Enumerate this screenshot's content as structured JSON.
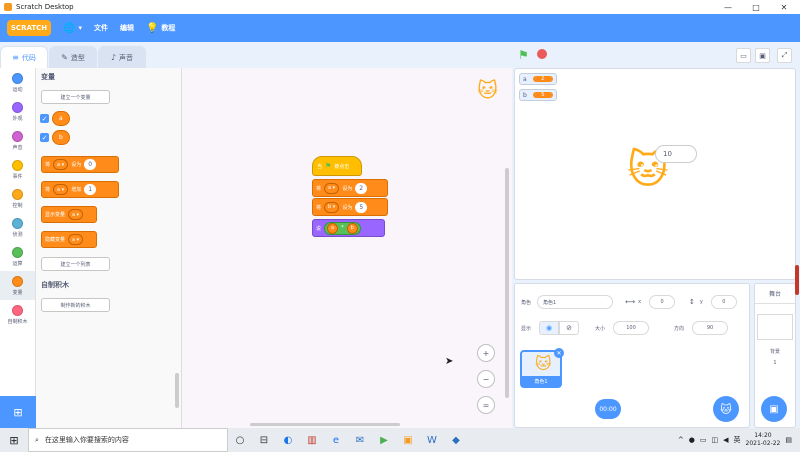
{
  "window": {
    "title": "Scratch Desktop",
    "controls": [
      "—",
      "□",
      "✕"
    ]
  },
  "menubar": {
    "logo_text": "SCRATCH",
    "items": [
      {
        "icon": "globe-icon",
        "label": ""
      },
      {
        "icon": "",
        "label": "文件"
      },
      {
        "icon": "",
        "label": "编辑"
      },
      {
        "icon": "lightbulb-icon",
        "label": "教程"
      }
    ]
  },
  "tabs": [
    {
      "label": "代码",
      "icon": "code-icon",
      "active": true
    },
    {
      "label": "造型",
      "icon": "brush-icon",
      "active": false
    },
    {
      "label": "声音",
      "icon": "speaker-icon",
      "active": false
    }
  ],
  "categories": [
    {
      "label": "运动",
      "color": "#4c97ff"
    },
    {
      "label": "外观",
      "color": "#9966ff"
    },
    {
      "label": "声音",
      "color": "#cf63cf"
    },
    {
      "label": "事件",
      "color": "#ffbf00"
    },
    {
      "label": "控制",
      "color": "#ffab19"
    },
    {
      "label": "侦测",
      "color": "#5cb1d6"
    },
    {
      "label": "运算",
      "color": "#59c059"
    },
    {
      "label": "变量",
      "color": "#ff8c1a"
    },
    {
      "label": "自制积木",
      "color": "#ff6680"
    }
  ],
  "flyout": {
    "variables_heading": "变量",
    "make_variable": "建立一个变量",
    "vars": [
      "a",
      "b"
    ],
    "set_block": {
      "prefix": "将",
      "var": "a",
      "verb": "设为",
      "value": "0"
    },
    "change_block": {
      "prefix": "将",
      "var": "a",
      "verb": "增加",
      "value": "1"
    },
    "show_var": {
      "label": "显示变量",
      "var": "a"
    },
    "hide_var": {
      "label": "隐藏变量",
      "var": "a"
    },
    "make_list": "建立一个列表",
    "myblocks_heading": "自制积木",
    "make_block": "制作新的积木"
  },
  "script": {
    "hat": {
      "label": "当",
      "flag": "⚑",
      "suffix": "被点击"
    },
    "set1": {
      "prefix": "将",
      "var": "a",
      "verb": "设为",
      "value": "2"
    },
    "set2": {
      "prefix": "将",
      "var": "b",
      "verb": "设为",
      "value": "5"
    },
    "say": {
      "label": "说",
      "left": "a",
      "op": "*",
      "right": "b"
    }
  },
  "zoom": {
    "in": "+",
    "out": "−",
    "reset": "="
  },
  "stage": {
    "monitors": [
      {
        "name": "a",
        "value": "2"
      },
      {
        "name": "b",
        "value": "5"
      }
    ],
    "speech": "10"
  },
  "sprite_info": {
    "sprite_label": "角色",
    "sprite_name": "角色1",
    "x_label": "x",
    "x_value": "0",
    "y_label": "y",
    "y_value": "0",
    "show_label": "显示",
    "size_label": "大小",
    "size_value": "100",
    "direction_label": "方向",
    "direction_value": "90",
    "tile_label": "角色1",
    "timer": "00:00"
  },
  "stage_pane": {
    "header": "舞台",
    "bg_label": "背景",
    "bg_count": "1"
  },
  "taskbar": {
    "search_placeholder": "在这里输入你要搜索的内容",
    "time": "14:20",
    "date": "2021-02-22",
    "ime": "英"
  },
  "colors": {
    "accent": "#4c97ff",
    "variables": "#ff8c1a",
    "events": "#ffbf00",
    "looks": "#9966ff"
  }
}
